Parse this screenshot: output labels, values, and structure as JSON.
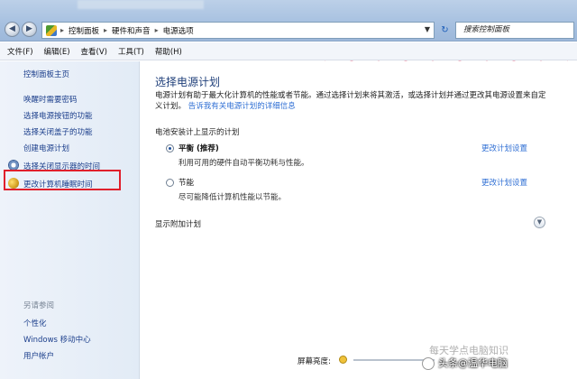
{
  "address_bar": {
    "breadcrumbs": [
      "控制面板",
      "硬件和声音",
      "电源选项"
    ],
    "search_placeholder": "搜索控制面板"
  },
  "menu": [
    "文件(F)",
    "编辑(E)",
    "查看(V)",
    "工具(T)",
    "帮助(H)"
  ],
  "sidebar": {
    "home": "控制面板主页",
    "links": [
      "唤醒时需要密码",
      "选择电源按钮的功能",
      "选择关闭盖子的功能",
      "创建电源计划",
      "选择关闭显示器的时间",
      "更改计算机睡眠时间"
    ],
    "see_also_heading": "另请参阅",
    "see_also": [
      "个性化",
      "Windows 移动中心",
      "用户帐户"
    ]
  },
  "main": {
    "title": "选择电源计划",
    "description": "电源计划有助于最大化计算机的性能或者节能。通过选择计划来将其激活，或选择计划并通过更改其电源设置来自定义计划。",
    "description_link": "告诉我有关电源计划的详细信息",
    "section_label": "电池安装计上显示的计划",
    "plans": [
      {
        "name": "平衡 (推荐)",
        "desc": "利用可用的硬件自动平衡功耗与性能。",
        "change": "更改计划设置",
        "checked": true
      },
      {
        "name": "节能",
        "desc": "尽可能降低计算机性能以节能。",
        "change": "更改计划设置",
        "checked": false
      }
    ],
    "more_plans": "显示附加计划",
    "brightness_label": "屏幕亮度:"
  },
  "watermark": {
    "line1": "每天学点电脑知识",
    "line2": "头条@温华电脑"
  }
}
